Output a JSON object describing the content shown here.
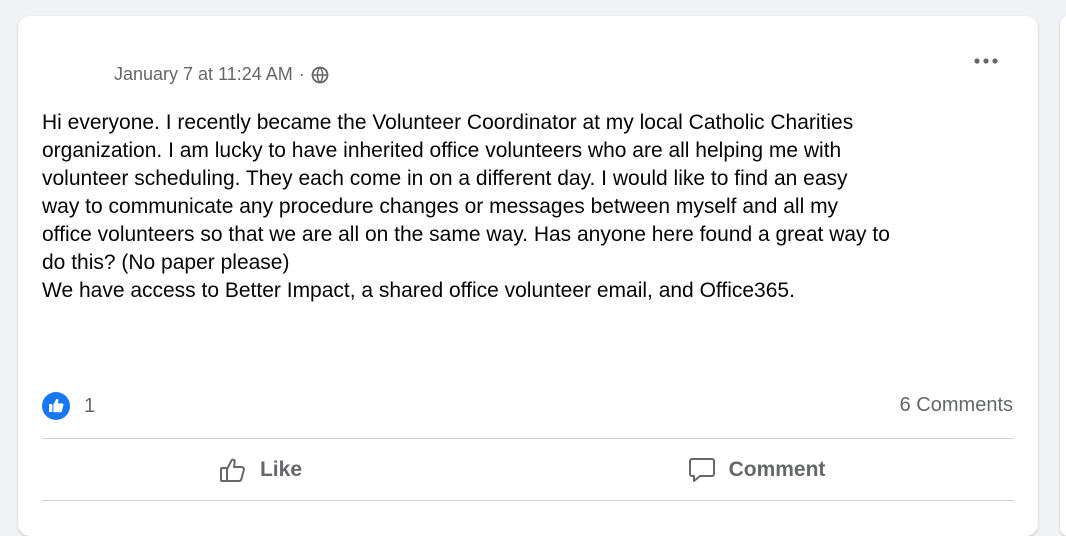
{
  "post": {
    "timestamp": "January 7 at 11:24 AM",
    "separator": "·",
    "privacy_icon": "globe-icon",
    "more_icon": "more-options-icon",
    "body": "Hi everyone. I recently became the Volunteer Coordinator at my local Catholic Charities\norganization. I am lucky to have inherited office volunteers who are all helping me with\nvolunteer scheduling. They each come in on a different day. I would like to find an easy\nway to communicate any procedure changes or messages between myself and all my\noffice volunteers so that we are all on the same way. Has anyone here found a great way to\ndo this? (No paper please)\nWe have access to Better Impact, a shared office volunteer email, and Office365."
  },
  "stats": {
    "reaction_icon": "like-reaction-icon",
    "reaction_count": "1",
    "comments": "6 Comments"
  },
  "actions": {
    "like_label": "Like",
    "comment_label": "Comment"
  },
  "colors": {
    "accent_blue": "#1877f2",
    "secondary_text": "#65676b",
    "primary_text": "#050505",
    "divider": "#ced0d4",
    "background": "#f0f2f5"
  }
}
